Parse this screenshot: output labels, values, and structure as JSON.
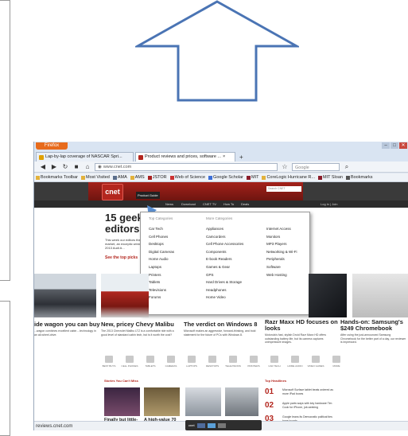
{
  "browser": {
    "app_button": "Firefox",
    "tabs": [
      {
        "label": "Lap-by-lap coverage of NASCAR Spri...",
        "active": false,
        "icon_color": "#e0a000"
      },
      {
        "label": "Product reviews and prices, software ...",
        "active": true,
        "icon_color": "#b3261e"
      }
    ],
    "new_tab": "+",
    "tab_close": "×",
    "url": "www.cnet.com",
    "search_placeholder": "Google",
    "bookmarks": [
      "Bookmarks Toolbar",
      "Most Visited",
      "AMA",
      "AMS",
      "JSTOR",
      "Web of Science",
      "Google Scholar",
      "MIT",
      "CoreLogic Hurricane R...",
      "MIT Sloan",
      "Bookmarks"
    ]
  },
  "cnet": {
    "logo": "cnet",
    "search_placeholder": "Search CNET",
    "login": "Log in | Join",
    "nav": [
      "Product Guide",
      "News",
      "Download",
      "CNET TV",
      "How To",
      "Deals"
    ],
    "hero": {
      "title_line1": "15 geeky",
      "title_line2": "editors' c",
      "text": "This week our editors the market, an exceptic winning 2013 Audi A...",
      "link": "See the top picks"
    },
    "dropdown": {
      "head_left": "Top Categories",
      "head_right": "More Categories",
      "col1": [
        "Car Tech",
        "Cell Phones",
        "Desktops",
        "Digital Cameras",
        "Home Audio",
        "Laptops",
        "Printers",
        "Tablets",
        "Televisions",
        "Forums"
      ],
      "col2": [
        "Appliances",
        "Camcorders",
        "Cell Phone Accessories",
        "Components",
        "E-book Readers",
        "Games & Gear",
        "GPS",
        "Hard Drives & Storage",
        "Headphones",
        "Home Video"
      ],
      "col3": [
        "Internet Access",
        "Monitors",
        "MP3 Players",
        "Networking & Wi-Fi",
        "Peripherals",
        "Software",
        "Web Hosting"
      ]
    },
    "articles": [
      {
        "title": "ide wagon you can buy",
        "text": "...wagon combines excellent cabin ...technology in an all-wheel-drive."
      },
      {
        "title": "New, pricey Chevy Malibu",
        "text": "The 2013 Chevrolet Malibu LTZ is a comfortable ride with a good level of standard cabin tech, but is it worth the cost?"
      },
      {
        "title": "The verdict on Windows 8",
        "text": "Microsoft makes an aggressive, forward-thinking, and bold statement for the future of PCs with Windows 8."
      },
      {
        "title": "Razr Maxx HD focuses on",
        "title2": "looks",
        "text": "Motorola's fast, stylish Droid Razr Maxx HD offers outstanding battery life, but its camera captures unimpressive images."
      },
      {
        "title": "Hands-on: Samsung's",
        "title2": "$249 Chromebook",
        "text": "After using the just-announced Samsung Chromebook for the better part of a day, our reviewer is impressed."
      }
    ],
    "categories": [
      "BEST BUYS",
      "CELL PHONES",
      "TABLETS",
      "CAMERAS",
      "LAPTOPS",
      "DESKTOPS",
      "TELEVISIONS",
      "PRINTERS",
      "CAR TECH",
      "HOME AUDIO",
      "VIDEO GAMES",
      "MORE"
    ],
    "sections": {
      "cant_miss": "Stories You Can't Miss",
      "top_headlines": "Top Headlines"
    },
    "bottom_captions": [
      "Finally but little-known iOS",
      "A high-value 70"
    ],
    "headlines": [
      {
        "rank": "01",
        "text": "Microsoft Surface tablet beats ordered as more iPad boxes"
      },
      {
        "rank": "02",
        "text": "Apple parts ways with key hardware Tim Cook for iPhone, job-seeking"
      },
      {
        "rank": "03",
        "text": "Google leans its Democratic political ties have boosts"
      }
    ],
    "status_url": "reviews.cnet.com",
    "taskbar": "cnet"
  }
}
